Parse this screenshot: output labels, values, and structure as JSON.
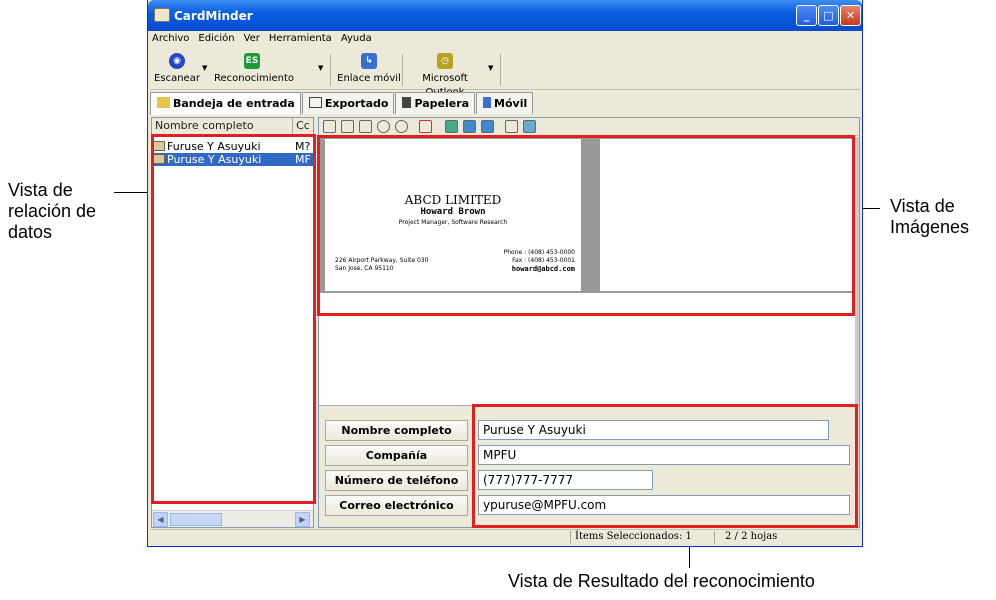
{
  "window": {
    "title": "CardMinder"
  },
  "menu": [
    "Archivo",
    "Edición",
    "Ver",
    "Herramienta",
    "Ayuda"
  ],
  "toolbar": {
    "scan_label": "Escanear",
    "recognition_label": "Reconocimiento",
    "mobile_link_label": "Enlace móvil",
    "outlook_label": "Microsoft Outlook"
  },
  "tabs": [
    "Bandeja de entrada",
    "Exportado",
    "Papelera",
    "Móvil"
  ],
  "list": {
    "columns": [
      "Nombre completo",
      "Cc"
    ],
    "rows": [
      {
        "name": "Furuse Y Asuyuki",
        "company": "M?"
      },
      {
        "name": "Puruse Y Asuyuki",
        "company": "MF"
      }
    ]
  },
  "card": {
    "company": "ABCD LIMITED",
    "person": "Howard Brown",
    "position": "Project Manager, Software Research",
    "address1": "226 Airport Parkway, Suite 030",
    "address2": "San Jose, CA 95110",
    "phone": "Phone : (408) 453-0000",
    "fax": "Fax : (408) 453-0001",
    "email": "howard@abcd.com"
  },
  "results": {
    "name_label": "Nombre completo",
    "name_value": "Puruse Y Asuyuki",
    "company_label": "Compañía",
    "company_value": "MPFU",
    "phone_label": "Número de teléfono",
    "phone_value": "(777)777-7777",
    "email_label": "Correo electrónico",
    "email_value": "ypuruse@MPFU.com"
  },
  "status": {
    "selected": "Ítems Seleccionados:  1",
    "pages": "2 /    2 hojas"
  },
  "annotations": {
    "data_relation": "Vista de relación de datos",
    "images": "Vista de Imágenes",
    "recognition": "Vista de Resultado del reconocimiento"
  },
  "colors": {
    "title_blue": "#0a5fe0",
    "highlight_red": "#e02020",
    "selection": "#316ac5"
  }
}
